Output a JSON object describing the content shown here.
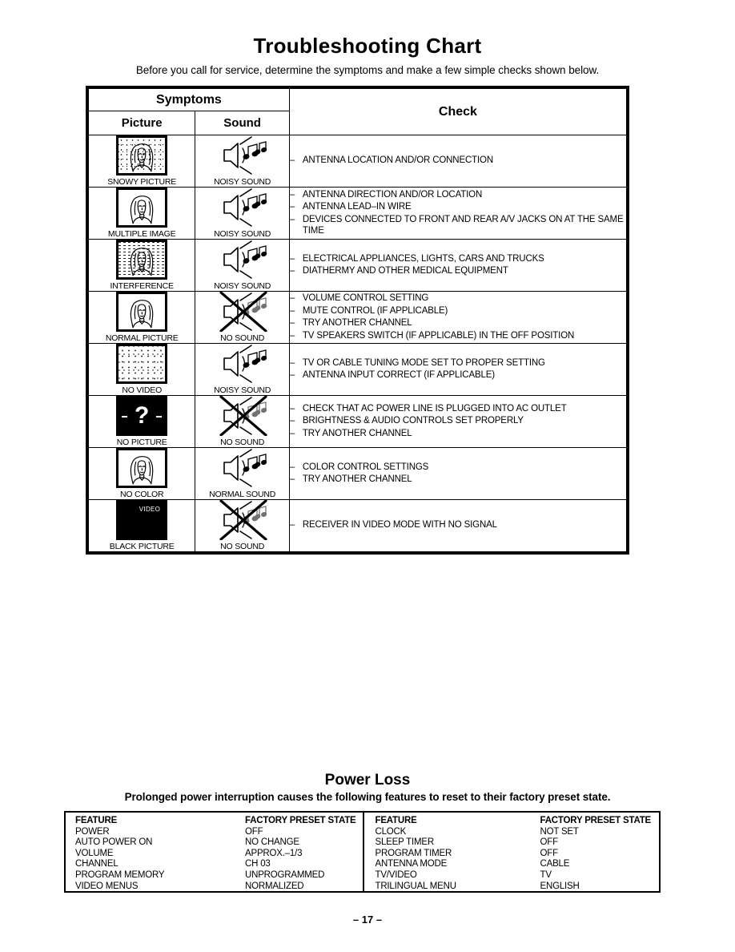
{
  "page": {
    "title": "Troubleshooting Chart",
    "subtitle": "Before you call for service, determine the symptoms and make a few simple checks shown below.",
    "page_number": "– 17 –"
  },
  "table": {
    "headers": {
      "symptoms": "Symptoms",
      "picture": "Picture",
      "sound": "Sound",
      "check": "Check"
    },
    "rows": [
      {
        "picture_icon": "snowy-picture-icon",
        "picture_label": "SNOWY PICTURE",
        "sound_icon": "noisy-sound-icon",
        "sound_label": "NOISY SOUND",
        "checks": [
          "ANTENNA LOCATION AND/OR CONNECTION"
        ]
      },
      {
        "picture_icon": "multiple-image-icon",
        "picture_label": "MULTIPLE IMAGE",
        "sound_icon": "noisy-sound-icon",
        "sound_label": "NOISY SOUND",
        "checks": [
          "ANTENNA DIRECTION AND/OR LOCATION",
          "ANTENNA LEAD–IN WIRE",
          "DEVICES CONNECTED TO FRONT AND REAR A/V JACKS ON AT THE SAME TIME"
        ]
      },
      {
        "picture_icon": "interference-icon",
        "picture_label": "INTERFERENCE",
        "sound_icon": "noisy-sound-icon",
        "sound_label": "NOISY SOUND",
        "checks": [
          "ELECTRICAL APPLIANCES, LIGHTS, CARS AND TRUCKS",
          "DIATHERMY AND OTHER MEDICAL EQUIPMENT"
        ]
      },
      {
        "picture_icon": "normal-picture-icon",
        "picture_label": "NORMAL PICTURE",
        "sound_icon": "no-sound-icon",
        "sound_label": "NO SOUND",
        "checks": [
          "VOLUME CONTROL SETTING",
          "MUTE CONTROL (IF APPLICABLE)",
          "TRY ANOTHER CHANNEL",
          "TV SPEAKERS SWITCH (IF APPLICABLE) IN THE OFF POSITION"
        ]
      },
      {
        "picture_icon": "no-video-icon",
        "picture_label": "NO VIDEO",
        "sound_icon": "noisy-sound-icon",
        "sound_label": "NOISY SOUND",
        "checks": [
          "TV OR CABLE TUNING MODE SET TO PROPER SETTING",
          "ANTENNA INPUT CORRECT (IF APPLICABLE)"
        ]
      },
      {
        "picture_icon": "no-picture-icon",
        "picture_label": "NO PICTURE",
        "picture_screen_text": "?",
        "sound_icon": "no-sound-icon",
        "sound_label": "NO SOUND",
        "checks": [
          "CHECK THAT AC POWER LINE  IS PLUGGED  INTO AC OUTLET",
          "BRIGHTNESS & AUDIO CONTROLS SET PROPERLY",
          "TRY ANOTHER CHANNEL"
        ]
      },
      {
        "picture_icon": "no-color-icon",
        "picture_label": "NO COLOR",
        "sound_icon": "normal-sound-icon",
        "sound_label": "NORMAL SOUND",
        "checks": [
          "COLOR CONTROL SETTINGS",
          "TRY ANOTHER CHANNEL"
        ]
      },
      {
        "picture_icon": "black-picture-icon",
        "picture_label": "BLACK PICTURE",
        "picture_screen_text": "VIDEO",
        "sound_icon": "no-sound-icon",
        "sound_label": "NO SOUND",
        "checks": [
          "RECEIVER IN VIDEO MODE WITH NO SIGNAL"
        ]
      }
    ]
  },
  "power_loss": {
    "title": "Power Loss",
    "subtitle": "Prolonged power interruption causes the following features to reset to their factory preset state.",
    "left": {
      "header": {
        "feature": "FEATURE",
        "state": "FACTORY PRESET STATE"
      },
      "rows": [
        {
          "feature": "POWER",
          "state": "OFF"
        },
        {
          "feature": "AUTO POWER ON",
          "state": "NO CHANGE"
        },
        {
          "feature": "VOLUME",
          "state": "APPROX.–1/3"
        },
        {
          "feature": "CHANNEL",
          "state": "CH 03"
        },
        {
          "feature": "PROGRAM MEMORY",
          "state": "UNPROGRAMMED"
        },
        {
          "feature": "VIDEO MENUS",
          "state": "NORMALIZED"
        }
      ]
    },
    "right": {
      "header": {
        "feature": "FEATURE",
        "state": "FACTORY PRESET STATE"
      },
      "rows": [
        {
          "feature": "CLOCK",
          "state": "NOT SET"
        },
        {
          "feature": "SLEEP TIMER",
          "state": "OFF"
        },
        {
          "feature": "PROGRAM TIMER",
          "state": "OFF"
        },
        {
          "feature": "ANTENNA MODE",
          "state": "CABLE"
        },
        {
          "feature": "TV/VIDEO",
          "state": "TV"
        },
        {
          "feature": "TRILINGUAL MENU",
          "state": "ENGLISH"
        }
      ]
    }
  },
  "colors": {
    "ink": "#000000",
    "paper": "#ffffff"
  }
}
